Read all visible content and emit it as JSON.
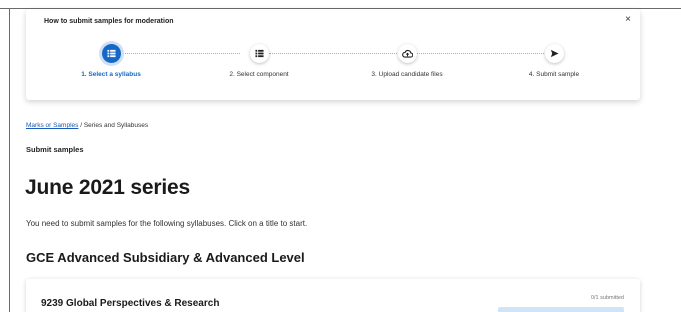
{
  "modal": {
    "title": "How to submit samples for moderation",
    "close_label": "×",
    "steps": [
      {
        "number": 1,
        "label": "1. Select a syllabus",
        "icon": "list-icon",
        "active": true
      },
      {
        "number": 2,
        "label": "2. Select component",
        "icon": "list-icon",
        "active": false
      },
      {
        "number": 3,
        "label": "3. Upload candidate files",
        "icon": "cloud-upload-icon",
        "active": false
      },
      {
        "number": 4,
        "label": "4. Submit sample",
        "icon": "send-icon",
        "active": false
      }
    ]
  },
  "breadcrumb": {
    "link": "Marks or Samples",
    "separator": "/",
    "current": "Series and Syllabuses"
  },
  "page": {
    "subtitle": "Submit samples",
    "title": "June 2021 series",
    "intro": "You need to submit samples for the following syllabuses. Click on a title to start.",
    "section_title": "GCE Advanced Subsidiary & Advanced Level"
  },
  "syllabuses": [
    {
      "title": "9239 Global Perspectives & Research",
      "status": "0/1 submitted"
    }
  ],
  "colors": {
    "accent": "#1568c5",
    "accent_halo": "#cfe0f5",
    "link": "#1a5ab8",
    "button_bg": "#cfe4f7"
  }
}
